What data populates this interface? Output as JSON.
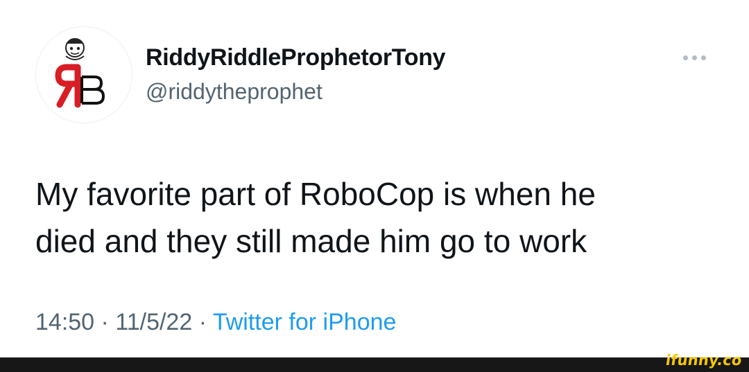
{
  "tweet": {
    "display_name": "RiddyRiddleProphetorTony",
    "handle": "@riddytheprophet",
    "text_lines": [
      "My favorite part of RoboCop is when he",
      "died and they still made him go to work"
    ],
    "time": "14:50",
    "date": "11/5/22",
    "separator": "·",
    "source": "Twitter for iPhone"
  },
  "avatar": {
    "logo_text": "ЯB",
    "colors": {
      "r": "#d81d25",
      "b": "#111111"
    }
  },
  "more_menu": {
    "icon": "more-horizontal-icon"
  },
  "watermark": {
    "text": "ifunny.co"
  },
  "colors": {
    "text_primary": "#0f1419",
    "text_secondary": "#536471",
    "link": "#1d9bf0",
    "footer_bg": "#171717",
    "watermark": "#f5c800"
  }
}
